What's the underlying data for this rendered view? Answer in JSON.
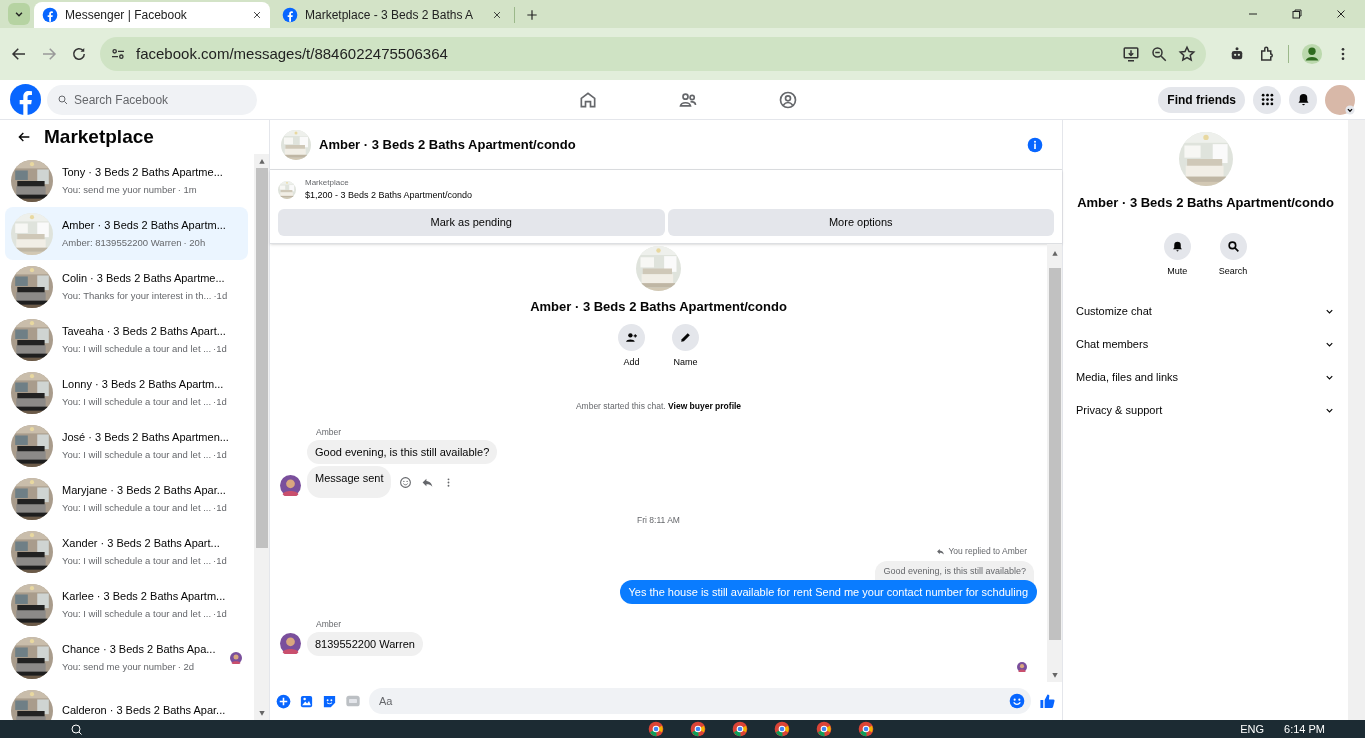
{
  "browser": {
    "tabs": [
      {
        "title": "Messenger | Facebook",
        "selected": true
      },
      {
        "title": "Marketplace - 3 Beds 2 Baths A",
        "selected": false
      }
    ],
    "url": "facebook.com/messages/t/8846022475506364"
  },
  "header": {
    "search_placeholder": "Search Facebook",
    "find_friends": "Find friends"
  },
  "sidebar": {
    "title": "Marketplace",
    "conversations": [
      {
        "name": "Tony · 3 Beds 2 Baths Apartme...",
        "preview": "You: send me yuor number",
        "time": "· 1m",
        "selected": false,
        "seen": false
      },
      {
        "name": "Amber · 3 Beds 2 Baths Apartm...",
        "preview": "Amber: 8139552200 Warren",
        "time": "· 20h",
        "selected": true,
        "seen": false
      },
      {
        "name": "Colin · 3 Beds 2 Baths Apartme...",
        "preview": "You: Thanks for your interest in th...",
        "time": "·1d",
        "selected": false,
        "seen": false
      },
      {
        "name": "Taveaha · 3 Beds 2 Baths Apart...",
        "preview": "You: I will schedule a tour and let ...",
        "time": "·1d",
        "selected": false,
        "seen": false
      },
      {
        "name": "Lonny · 3 Beds 2 Baths Apartm...",
        "preview": "You: I will schedule a tour and let ...",
        "time": "·1d",
        "selected": false,
        "seen": false
      },
      {
        "name": "José · 3 Beds 2 Baths Apartmen...",
        "preview": "You: I will schedule a tour and let ...",
        "time": "·1d",
        "selected": false,
        "seen": false
      },
      {
        "name": "Maryjane · 3 Beds 2 Baths Apar...",
        "preview": "You: I will schedule a tour and let ...",
        "time": "·1d",
        "selected": false,
        "seen": false
      },
      {
        "name": "Xander · 3 Beds 2 Baths Apart...",
        "preview": "You: I will schedule a tour and let ...",
        "time": "·1d",
        "selected": false,
        "seen": false
      },
      {
        "name": "Karlee · 3 Beds 2 Baths Apartm...",
        "preview": "You: I will schedule a tour and let ...",
        "time": "·1d",
        "selected": false,
        "seen": false
      },
      {
        "name": "Chance · 3 Beds 2 Baths Apa...",
        "preview": "You: send me your number",
        "time": "· 2d",
        "selected": false,
        "seen": true
      },
      {
        "name": "Calderon · 3 Beds 2 Baths Apar...",
        "selected": false,
        "seen": false
      }
    ]
  },
  "chat": {
    "title": "Amber · 3 Beds 2 Baths Apartment/condo",
    "listing": {
      "label": "Marketplace",
      "item": "$1,200 - 3 Beds 2 Baths Apartment/condo"
    },
    "actions": [
      "Mark as pending",
      "More options"
    ],
    "profile": {
      "name": "Amber · 3 Beds 2 Baths Apartment/condo",
      "buttons": [
        "Add",
        "Name"
      ]
    },
    "messages": [
      {
        "kind": "system",
        "text": "Amber started this chat.",
        "link": "View buyer profile"
      },
      {
        "kind": "sender",
        "text": "Amber"
      },
      {
        "kind": "incoming",
        "text": "Good evening, is this still available?",
        "avatar": false,
        "actions": false
      },
      {
        "kind": "incoming",
        "text": "Message sent",
        "avatar": true,
        "actions": true
      },
      {
        "kind": "date",
        "text": "Fri 8:11 AM"
      },
      {
        "kind": "reply_note",
        "text": "You replied to Amber"
      },
      {
        "kind": "quote",
        "text": "Good evening, is this still available?"
      },
      {
        "kind": "outgoing",
        "text": "Yes the house is still available for rent Send me your contact number for schduling"
      },
      {
        "kind": "sender",
        "text": "Amber"
      },
      {
        "kind": "incoming",
        "text": "8139552200 Warren",
        "avatar": true,
        "actions": false
      },
      {
        "kind": "seen"
      }
    ],
    "composer": {
      "placeholder": "Aa"
    }
  },
  "details": {
    "name": "Amber · 3 Beds 2 Baths Apartment/condo",
    "buttons": [
      "Mute",
      "Search"
    ],
    "sections": [
      "Customize chat",
      "Chat members",
      "Media, files and links",
      "Privacy & support"
    ]
  },
  "taskbar": {
    "language": "ENG",
    "time": "6:14 PM"
  }
}
